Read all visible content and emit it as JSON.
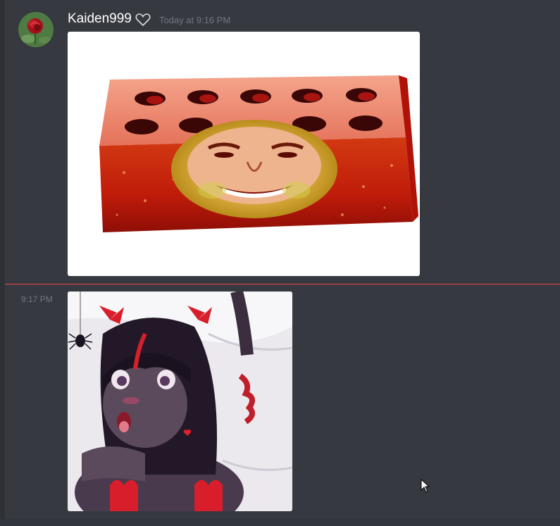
{
  "message": {
    "username": "Kaiden999",
    "timestamp": "Today at 9:16 PM",
    "username_color": "#ffffff",
    "avatar_icon": "rose-icon",
    "badge_icon": "heart-icon"
  },
  "followup": {
    "timestamp": "9:17 PM"
  },
  "attachments": [
    {
      "kind": "image",
      "description_icon": "brick-image"
    },
    {
      "kind": "image",
      "description_icon": "anime-character-image"
    }
  ],
  "colors": {
    "background": "#36393f",
    "sidebar": "#2f3136",
    "divider": "#f04747",
    "muted_text": "#72767d"
  }
}
